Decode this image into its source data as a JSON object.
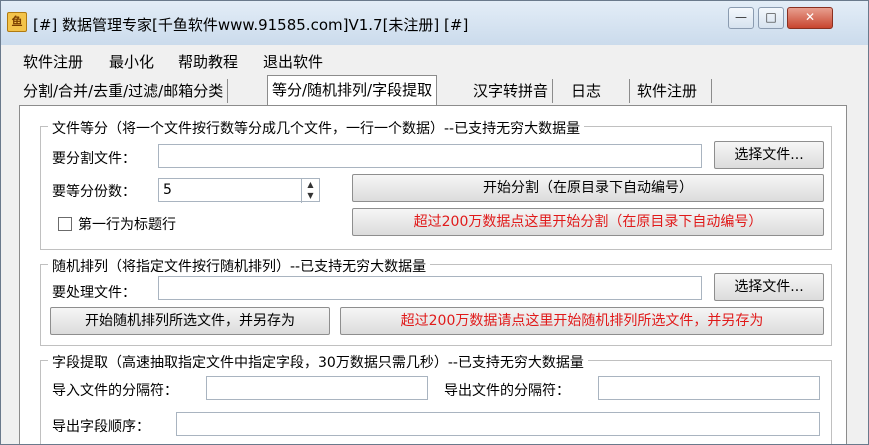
{
  "window": {
    "title": "[#] 数据管理专家[千鱼软件www.91585.com]V1.7[未注册] [#]"
  },
  "menu": {
    "items": [
      "软件注册",
      "最小化",
      "帮助教程",
      "退出软件"
    ]
  },
  "tabs": [
    "分割/合并/去重/过滤/邮箱分类",
    "等分/随机排列/字段提取",
    "汉字转拼音",
    "日志",
    "软件注册"
  ],
  "split": {
    "legend": "文件等分（将一个文件按行数等分成几个文件，一行一个数据）--已支持无穷大数据量",
    "file_label": "要分割文件：",
    "file_value": "",
    "choose_btn": "选择文件...",
    "count_label": "要等分份数：",
    "count_value": "5",
    "start_btn": "开始分割（在原目录下自动编号）",
    "header_checkbox": "第一行为标题行",
    "big_btn": "超过200万数据点这里开始分割（在原目录下自动编号）"
  },
  "shuffle": {
    "legend": "随机排列（将指定文件按行随机排列）--已支持无穷大数据量",
    "file_label": "要处理文件：",
    "file_value": "",
    "choose_btn": "选择文件...",
    "start_btn": "开始随机排列所选文件，并另存为",
    "big_btn": "超过200万数据请点这里开始随机排列所选文件，并另存为"
  },
  "extract": {
    "legend": "字段提取（高速抽取指定文件中指定字段，30万数据只需几秒）--已支持无穷大数据量",
    "import_sep_label": "导入文件的分隔符：",
    "import_sep_value": "",
    "export_sep_label": "导出文件的分隔符：",
    "export_sep_value": "",
    "order_label": "导出字段顺序：",
    "order_value": ""
  }
}
